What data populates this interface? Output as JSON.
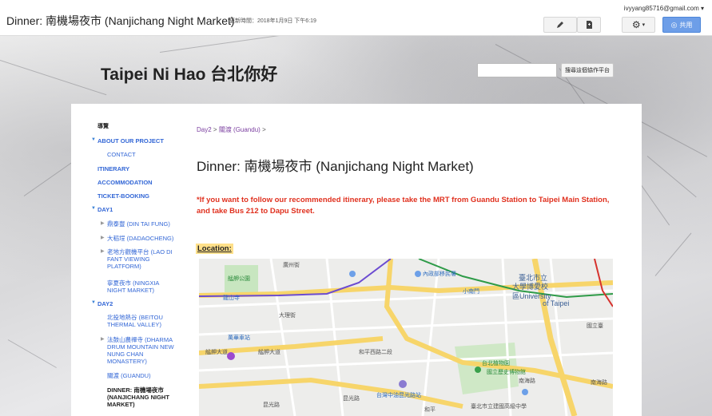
{
  "topbar": {
    "page_name": "Dinner: 南機場夜市 (Nanjichang Night Market)",
    "updated": "更新時間：2018年1月9日 下午6:19",
    "account": "ivyyang85716@gmail.com",
    "edit_icon": "pencil-icon",
    "page_icon": "new-page-icon",
    "settings_icon": "gear-icon",
    "share_label": "共用"
  },
  "site": {
    "title": "Taipei Ni Hao 台北你好",
    "search_button": "搜尋這個協作平台",
    "search_placeholder": ""
  },
  "sidebar": {
    "heading": "導覽",
    "items": [
      {
        "label": "ABOUT OUR PROJECT"
      },
      {
        "label": "CONTACT"
      },
      {
        "label": "ITINERARY"
      },
      {
        "label": "ACCOMMODATION"
      },
      {
        "label": "TICKET-BOOKING"
      },
      {
        "label": "DAY1"
      },
      {
        "label": "鼎泰豐 (DIN TAI FUNG)"
      },
      {
        "label": "大稻埕 (DADAOCHENG)"
      },
      {
        "label": "老地方觀機平台 (LAO DI FANT VIEWING PLATFORM)"
      },
      {
        "label": "寧夏夜市 (NINGXIA NIGHT MARKET)"
      },
      {
        "label": "DAY2"
      },
      {
        "label": "北投地熱谷 (BEITOU THERMAL VALLEY)"
      },
      {
        "label": "法鼓山農禪寺 (DHARMA DRUM MOUNTAIN NEW NUNG CHAN MONASTERY)"
      },
      {
        "label": "關渡 (GUANDU)"
      },
      {
        "label": "DINNER: 南機場夜市 (NANJICHANG NIGHT MARKET)"
      }
    ]
  },
  "main": {
    "breadcrumb_link1": "Day2",
    "breadcrumb_sep": ">",
    "breadcrumb_link2": "關渡 (Guandu)",
    "title": "Dinner: 南機場夜市 (Nanjichang Night Market)",
    "note": "*If you want to follow our recommended itinerary, please take the MRT from Guandu Station to Taipei Main Station, and take Bus 212 to Dapu Street.",
    "location_label": "Location:"
  },
  "map": {
    "labels": [
      "廣州街",
      "內政部移民署",
      "臺北市立",
      "大學博愛校",
      "區University",
      "of Taipei",
      "艋舺公園",
      "龍山寺",
      "小南門",
      "大理街",
      "萬華車站",
      "國立臺",
      "艋舺大道",
      "艋舺大道",
      "和平西路二段",
      "台北植物園",
      "國立歷史博物館",
      "南海路",
      "南海路",
      "台灣中油昆光路站",
      "昆光路",
      "昆光路",
      "臺北市立建國高級中學",
      "和平"
    ]
  }
}
